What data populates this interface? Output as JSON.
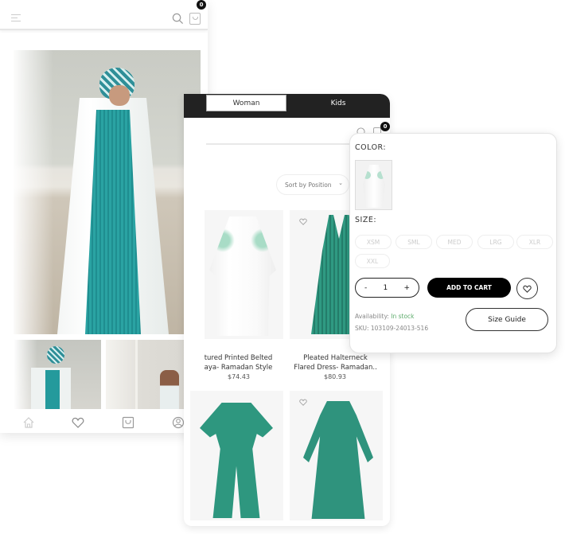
{
  "left_screen": {
    "cart_count": "0",
    "icons": {
      "menu": "hamburger-menu-icon",
      "search": "search-icon",
      "cart": "shopping-bag-icon"
    },
    "hero_image": "model in white printed abaya over teal pleated dress",
    "thumbnails": [
      "model close-up in teal headscarf and white abaya",
      "model walking away under arch"
    ],
    "tab_bar": [
      "home-icon",
      "heart-icon",
      "bag-icon",
      "user-icon"
    ]
  },
  "middle_screen": {
    "tabs": [
      {
        "label": "Woman",
        "active": false
      },
      {
        "label": "Kids",
        "active": true
      }
    ],
    "cart_count": "0",
    "sort_label": "Sort by Position",
    "products": [
      {
        "name_line1": "tured Printed Belted",
        "name_line2": "aya- Ramadan Style",
        "price": "$74.43",
        "image": "white printed belted abaya"
      },
      {
        "name_line1": "Pleated Halterneck",
        "name_line2": "Flared Dress- Ramadan..",
        "price": "$80.93",
        "image": "teal pleated halterneck dress"
      },
      {
        "name_line1": "",
        "name_line2": "",
        "price": "",
        "image": "teal wide-leg jumpsuit"
      },
      {
        "name_line1": "",
        "name_line2": "",
        "price": "",
        "image": "teal hooded kaftan"
      }
    ]
  },
  "quick_view": {
    "color_label": "COLOR:",
    "size_label": "SIZE:",
    "sizes": [
      "XSM",
      "SML",
      "MED",
      "LRG",
      "XLR",
      "XXL"
    ],
    "quantity": {
      "minus": "-",
      "value": "1",
      "plus": "+"
    },
    "add_to_cart_label": "ADD TO CART",
    "availability_label": "Availability:",
    "availability_value": "In stock",
    "sku": "SKU: 103109-24013-516",
    "size_guide_label": "Size Guide"
  },
  "colors": {
    "accent_black": "#000000",
    "tab_bar_dark": "#222222",
    "in_stock_green": "#5cab6b",
    "teal": "#2f977f"
  }
}
